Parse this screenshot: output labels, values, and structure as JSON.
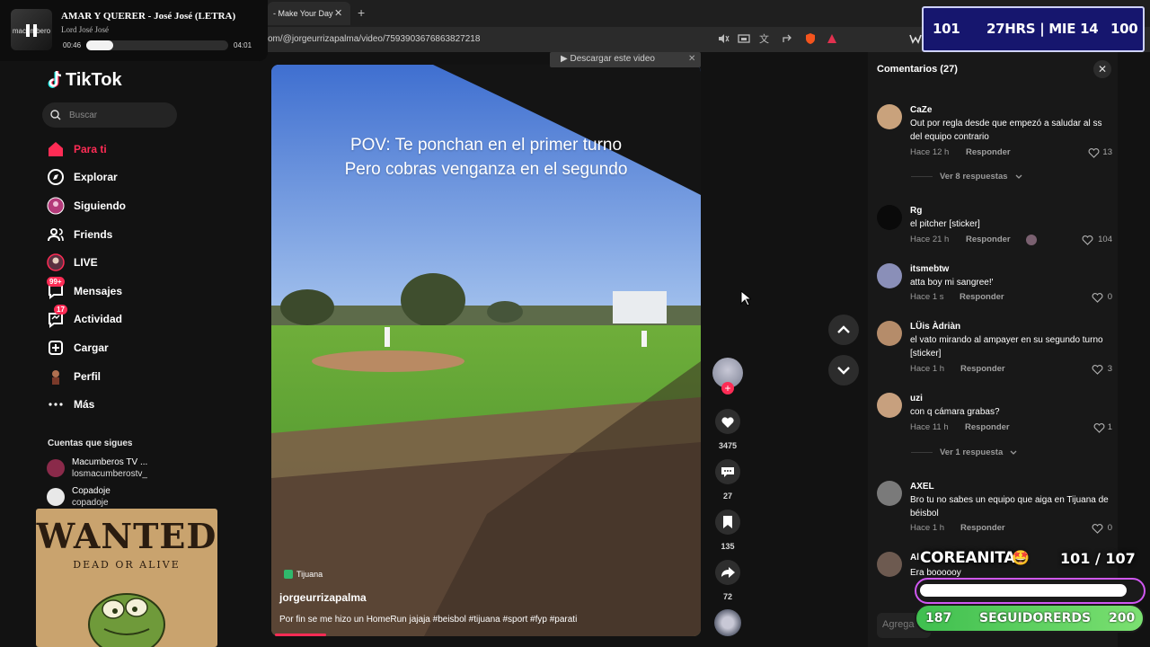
{
  "browser": {
    "tab_title": "- Make Your Day",
    "url": "om/@jorgeurrizapalma/video/7593903676863827218",
    "new_tab": "+",
    "close": "✕"
  },
  "music": {
    "art_label": "macumbero",
    "title": "AMAR Y QUERER - José José (LETRA)",
    "artist": "Lord José José",
    "time_current": "00:46",
    "time_total": "04:01",
    "progress": 0.19
  },
  "sidebar": {
    "logo": "TikTok",
    "search_placeholder": "Buscar",
    "nav": [
      {
        "label": "Para ti",
        "active": true
      },
      {
        "label": "Explorar"
      },
      {
        "label": "Siguiendo"
      },
      {
        "label": "Friends"
      },
      {
        "label": "LIVE"
      },
      {
        "label": "Mensajes",
        "badge": "99+"
      },
      {
        "label": "Actividad",
        "badge": "17"
      },
      {
        "label": "Cargar"
      },
      {
        "label": "Perfil"
      },
      {
        "label": "Más"
      }
    ],
    "following_header": "Cuentas que sigues",
    "accounts": [
      {
        "name": "Macumberos TV ...",
        "handle": "losmacumberostv_"
      },
      {
        "name": "Copadoje",
        "handle": "copadoje"
      }
    ]
  },
  "wanted": {
    "title": "WANTED",
    "subtitle": "DEAD OR ALIVE"
  },
  "video": {
    "download_label": "▶ Descargar este video",
    "download_close": "✕",
    "overlay_line1": "POV: Te ponchan en el primer turno",
    "overlay_line2": "Pero cobras venganza en el segundo",
    "location": "Tijuana",
    "author": "jorgeurrizapalma",
    "caption": "Por fin se me hizo un HomeRun jajaja #beisbol #tijuana #sport #fyp #parati",
    "progress": 0.12
  },
  "actions": {
    "likes": "3475",
    "comments": "27",
    "saves": "135",
    "shares": "72"
  },
  "comments": {
    "title": "Comentarios (27)",
    "reply_label": "Responder",
    "items": [
      {
        "user": "CaZe",
        "text": "Out por regla desde que empezó a saludar al ss del equipo contrario",
        "time": "Hace 12 h",
        "likes": "13",
        "more": "Ver 8 respuestas",
        "avatar": "#c9a27c"
      },
      {
        "user": "Rg",
        "text": "el pitcher [sticker]",
        "time": "Hace 21 h",
        "likes": "104",
        "avatar": "#0a0a0a"
      },
      {
        "user": "itsmebtw",
        "text": "atta boy mi sangree!'",
        "time": "Hace 1 s",
        "likes": "0",
        "avatar": "#8a8fb8"
      },
      {
        "user": "LÜis Àdriàn",
        "text": "el vato mirando al ampayer en su segundo turno [sticker]",
        "time": "Hace 1 h",
        "likes": "3",
        "avatar": "#b58c6a"
      },
      {
        "user": "uzi",
        "text": "con q cámara grabas?",
        "time": "Hace 11 h",
        "likes": "1",
        "more": "Ver 1 respuesta",
        "avatar": "#c7a07e"
      },
      {
        "user": "AXEL",
        "text": "Bro tu no sabes un equipo que aiga en Tijuana de béisbol",
        "time": "Hace 1 h",
        "likes": "0",
        "avatar": "#7a7a7a"
      },
      {
        "user": "Al",
        "text": "Era boooooy",
        "time": "",
        "likes": "",
        "avatar": "#6d5a50"
      }
    ],
    "add_placeholder": "Agrega"
  },
  "overlay": {
    "hud_left": "101",
    "hud_mid": "27HRS | MIE 14",
    "hud_right": "100",
    "goal_title": "COREANITAS",
    "goal_count": "101  / 107",
    "goal_progress": 0.94,
    "followers_left": "187",
    "followers_mid": "SEGUIDORERDS",
    "followers_right": "200"
  }
}
